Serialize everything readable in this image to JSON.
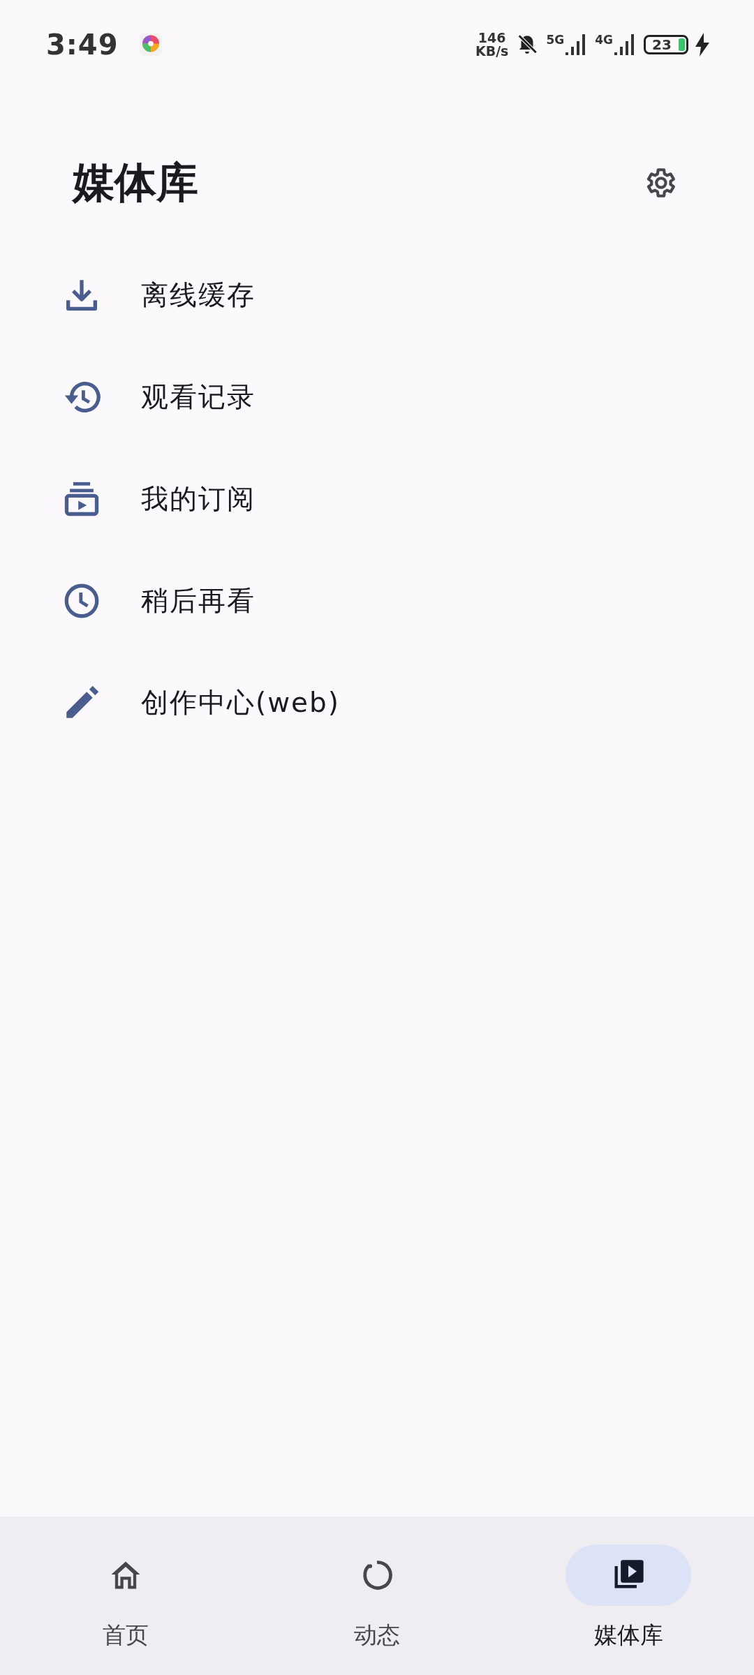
{
  "status_bar": {
    "time": "3:49",
    "speed_value": "146",
    "speed_unit": "KB/s",
    "networks": [
      {
        "label": "5G"
      },
      {
        "label": "4G"
      }
    ],
    "battery": "23",
    "charging": true
  },
  "header": {
    "title": "媒体库"
  },
  "menu": [
    {
      "kind": "download",
      "label": "离线缓存"
    },
    {
      "kind": "history",
      "label": "观看记录"
    },
    {
      "kind": "subscriptions",
      "label": "我的订阅"
    },
    {
      "kind": "clock",
      "label": "稍后再看"
    },
    {
      "kind": "edit",
      "label": "创作中心(web)"
    }
  ],
  "nav": [
    {
      "kind": "home",
      "label": "首页",
      "selected": false
    },
    {
      "kind": "feed",
      "label": "动态",
      "selected": false
    },
    {
      "kind": "library",
      "label": "媒体库",
      "selected": true
    }
  ]
}
